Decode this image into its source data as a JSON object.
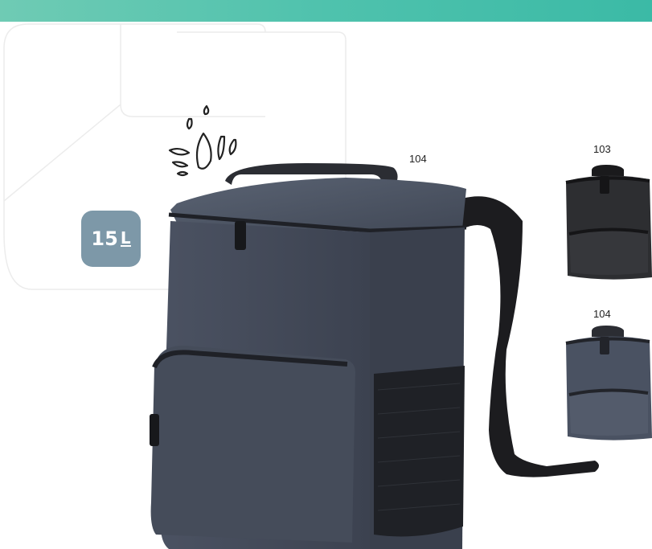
{
  "badge": {
    "number": "15",
    "unit": "L"
  },
  "main_bag": {
    "color_code": "104"
  },
  "variants": [
    {
      "color_code": "103"
    },
    {
      "color_code": "104"
    }
  ],
  "colors": {
    "band": "#4fc2ad",
    "badge": "#7d98a8",
    "fabric_grey": "#4a5262",
    "fabric_black": "#2a2a2c",
    "strap": "#1b1b1d"
  },
  "icons": [
    "water-drops-icon"
  ]
}
